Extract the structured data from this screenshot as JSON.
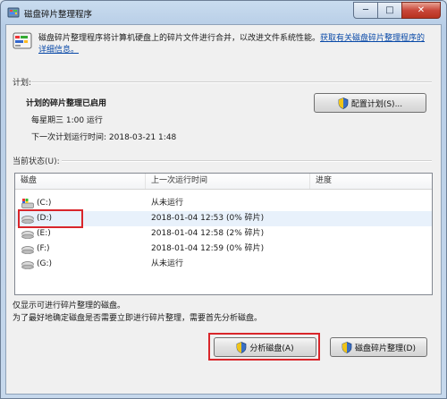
{
  "window": {
    "title": "磁盘碎片整理程序",
    "min_glyph": "─",
    "max_glyph": "□",
    "close_glyph": "✕"
  },
  "intro": {
    "text": "磁盘碎片整理程序将计算机硬盘上的碎片文件进行合并，以改进文件系统性能。",
    "link": "获取有关磁盘碎片整理程序的详细信息。"
  },
  "schedule": {
    "label": "计划:",
    "status": "计划的碎片整理已启用",
    "when": "每星期三 1:00 运行",
    "next_run": "下一次计划运行时间: 2018-03-21 1:48",
    "configure_button": "配置计划(S)..."
  },
  "current": {
    "label": "当前状态(U):",
    "columns": [
      "磁盘",
      "上一次运行时间",
      "进度"
    ],
    "rows": [
      {
        "disk": "(C:)",
        "last_run": "从未运行",
        "progress": "",
        "icon": "system-drive-icon"
      },
      {
        "disk": "(D:)",
        "last_run": "2018-01-04 12:53 (0% 碎片)",
        "progress": "",
        "icon": "drive-icon"
      },
      {
        "disk": "(E:)",
        "last_run": "2018-01-04 12:58 (2% 碎片)",
        "progress": "",
        "icon": "drive-icon"
      },
      {
        "disk": "(F:)",
        "last_run": "2018-01-04 12:59 (0% 碎片)",
        "progress": "",
        "icon": "drive-icon"
      },
      {
        "disk": "(G:)",
        "last_run": "从未运行",
        "progress": "",
        "icon": "drive-icon"
      }
    ],
    "selected_row": 1
  },
  "footer": {
    "line1": "仅显示可进行碎片整理的磁盘。",
    "line2": "为了最好地确定磁盘是否需要立即进行碎片整理，需要首先分析磁盘。"
  },
  "buttons": {
    "analyze": "分析磁盘(A)",
    "defrag": "磁盘碎片整理(D)"
  },
  "colors": {
    "highlight": "#d9262b",
    "link": "#0a4aa8"
  }
}
